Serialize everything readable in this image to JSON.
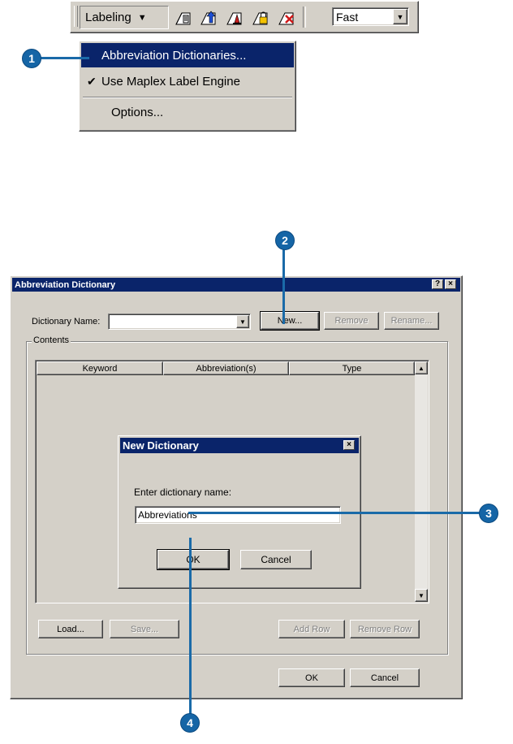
{
  "toolbar": {
    "labeling_menu_label": "Labeling",
    "icons": [
      "label-manager-icon",
      "label-priority-icon",
      "label-weight-icon",
      "lock-labels-icon",
      "view-unplaced-labels-icon"
    ],
    "quality_value": "Fast"
  },
  "menu": {
    "items": [
      {
        "label": "Abbreviation Dictionaries...",
        "selected": true
      },
      {
        "label": "Use Maplex Label Engine",
        "checked": true
      },
      {
        "label": "Options..."
      }
    ]
  },
  "dialog": {
    "title": "Abbreviation Dictionary",
    "help_btn": "?",
    "close_btn": "×",
    "dictionary_name_label": "Dictionary Name:",
    "dictionary_name_value": "",
    "new_btn": "New...",
    "remove_btn": "Remove",
    "rename_btn": "Rename...",
    "contents_label": "Contents",
    "columns": [
      "Keyword",
      "Abbreviation(s)",
      "Type"
    ],
    "load_btn": "Load...",
    "save_btn": "Save...",
    "add_row_btn": "Add Row",
    "remove_row_btn": "Remove Row",
    "ok_btn": "OK",
    "cancel_btn": "Cancel"
  },
  "new_dialog": {
    "title": "New Dictionary",
    "close_btn": "×",
    "prompt": "Enter dictionary name:",
    "name_value": "Abbreviations",
    "ok_btn": "OK",
    "cancel_btn": "Cancel"
  },
  "callouts": [
    "1",
    "2",
    "3",
    "4"
  ],
  "colors": {
    "accent": "#0a246a",
    "callout": "#1565a6",
    "face": "#d4d0c8"
  }
}
